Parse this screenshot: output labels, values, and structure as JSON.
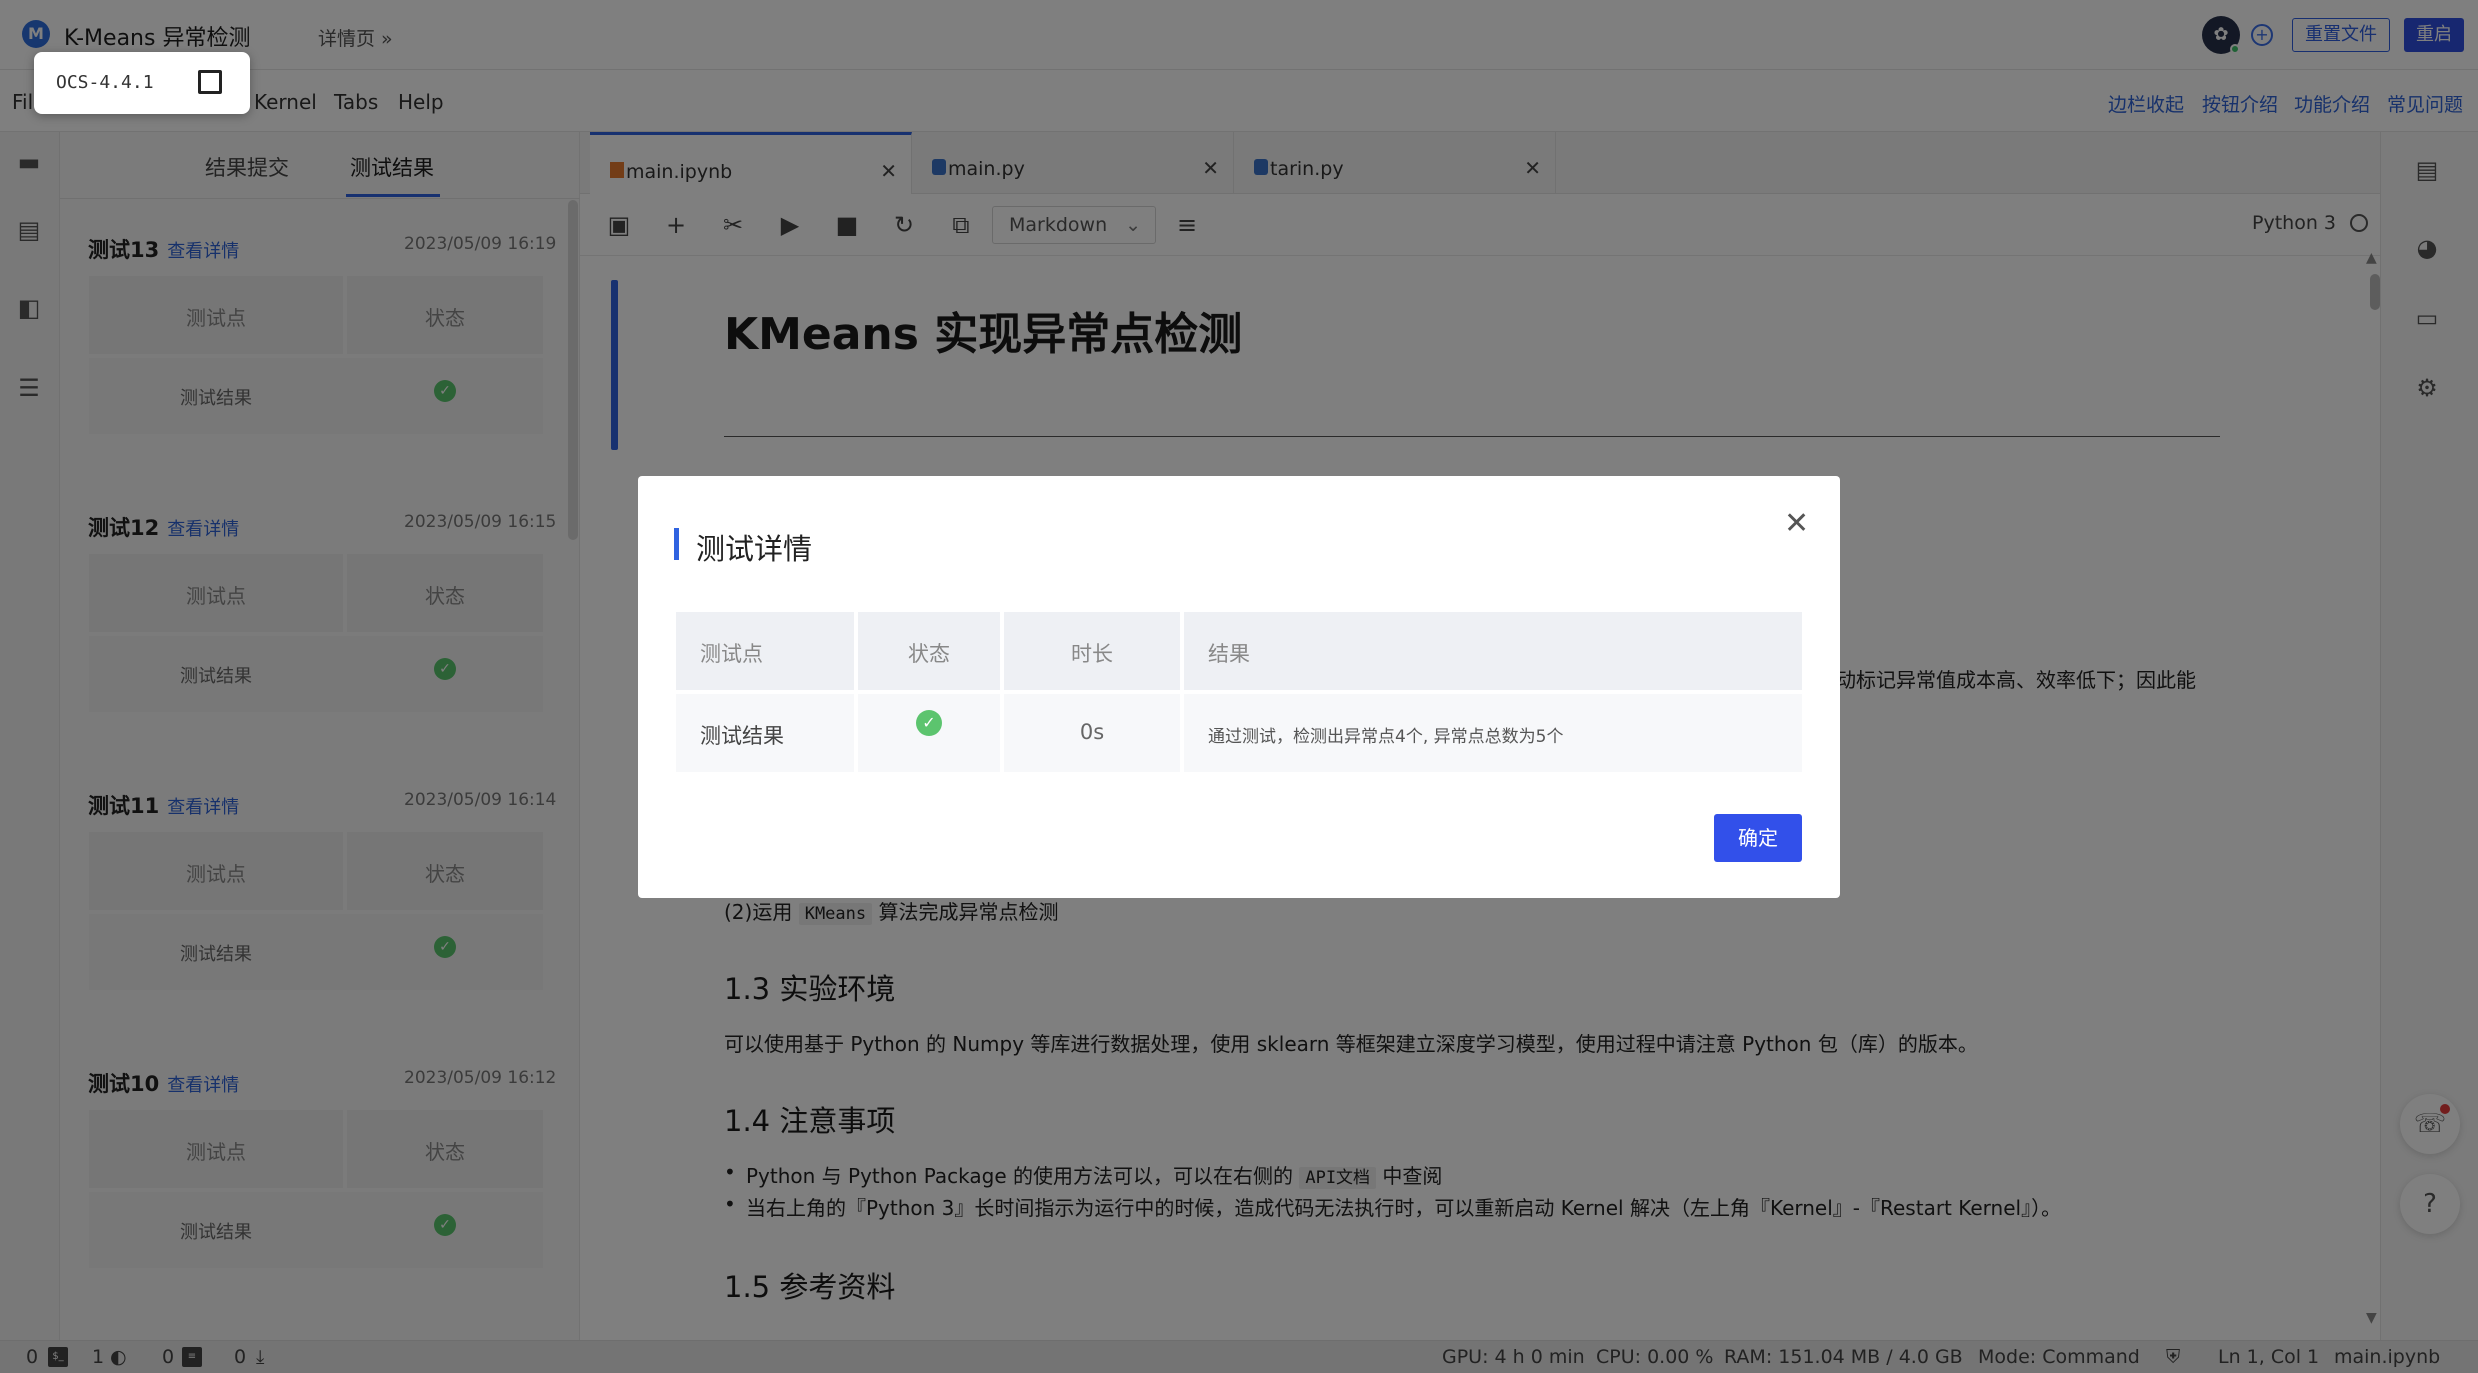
{
  "app": {
    "logo_letter": "M",
    "title": "K-Means 异常检测",
    "breadcrumb": "详情页 »",
    "reset_button": "重置文件",
    "restart_button": "重启"
  },
  "ocs": {
    "label": "OCS-4.4.1"
  },
  "menu": {
    "items": [
      "Fil",
      "Kernel",
      "Tabs",
      "Help"
    ],
    "right_links": [
      "边栏收起",
      "按钮介绍",
      "功能介绍",
      "常见问题"
    ]
  },
  "left_panel": {
    "tabs": [
      "结果提交",
      "测试结果"
    ],
    "tests": [
      {
        "title": "测试13",
        "link": "查看详情",
        "time": "2023/05/09 16:19",
        "col1": "测试点",
        "col2": "状态",
        "row": "测试结果"
      },
      {
        "title": "测试12",
        "link": "查看详情",
        "time": "2023/05/09 16:15",
        "col1": "测试点",
        "col2": "状态",
        "row": "测试结果"
      },
      {
        "title": "测试11",
        "link": "查看详情",
        "time": "2023/05/09 16:14",
        "col1": "测试点",
        "col2": "状态",
        "row": "测试结果"
      },
      {
        "title": "测试10",
        "link": "查看详情",
        "time": "2023/05/09 16:12",
        "col1": "测试点",
        "col2": "状态",
        "row": "测试结果"
      }
    ]
  },
  "editor": {
    "tabs": [
      {
        "label": "main.ipynb"
      },
      {
        "label": "main.py"
      },
      {
        "label": "tarin.py"
      }
    ],
    "cell_type": "Markdown",
    "kernel": "Python 3",
    "doc": {
      "h1": "KMeans 实现异常点检测",
      "partial_line": "动标记异常值成本高、效率低下；因此能",
      "item2_prefix": "(2)运用",
      "item2_code": "KMeans",
      "item2_suffix": "算法完成异常点检测",
      "h2_env": "1.3 实验环境",
      "env_text": "可以使用基于 Python 的 Numpy 等库进行数据处理，使用 sklearn 等框架建立深度学习模型，使用过程中请注意 Python 包（库）的版本。",
      "h2_notes": "1.4 注意事项",
      "note1_prefix": "Python 与 Python Package 的使用方法可以，可以在右侧的",
      "note1_code": "API文档",
      "note1_suffix": "中查阅",
      "note2": "当右上角的『Python 3』长时间指示为运行中的时候，造成代码无法执行时，可以重新启动 Kernel 解决（左上角『Kernel』-『Restart Kernel』）。",
      "h2_refs": "1.5 参考资料"
    }
  },
  "statusbar": {
    "terminals": "0",
    "kernels": "1",
    "files": "0",
    "downloads": "0",
    "gpu": "GPU: 4 h 0 min",
    "cpu": "CPU: 0.00 %",
    "ram": "RAM: 151.04 MB / 4.0 GB",
    "mode": "Mode: Command",
    "position": "Ln 1, Col 1",
    "file": "main.ipynb"
  },
  "modal": {
    "title": "测试详情",
    "headers": [
      "测试点",
      "状态",
      "时长",
      "结果"
    ],
    "row": {
      "point": "测试结果",
      "duration": "0s",
      "result": "通过测试，检测出异常点4个, 异常点总数为5个"
    },
    "ok_button": "确定"
  },
  "colors": {
    "accent": "#2f63e0",
    "success": "#5cc46e",
    "primary_button": "#3250ea"
  }
}
